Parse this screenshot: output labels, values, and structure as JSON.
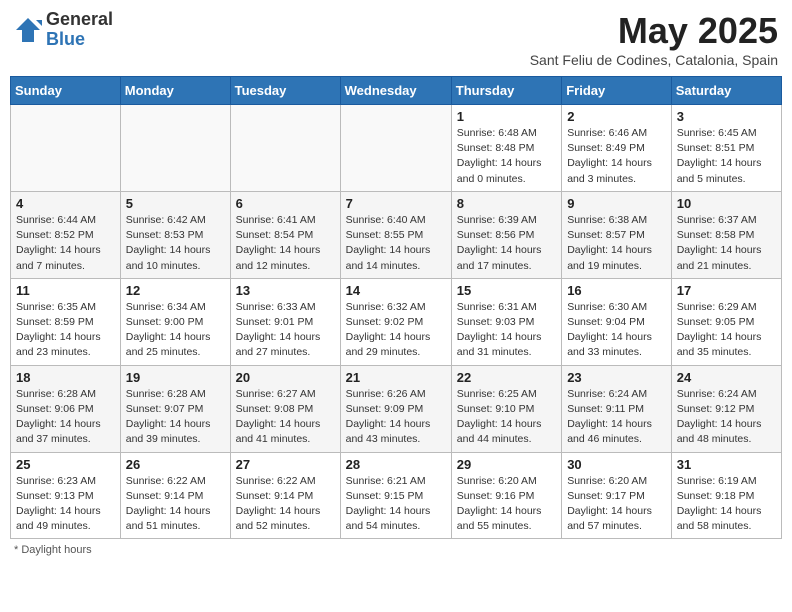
{
  "header": {
    "logo_general": "General",
    "logo_blue": "Blue",
    "month_title": "May 2025",
    "location": "Sant Feliu de Codines, Catalonia, Spain"
  },
  "weekdays": [
    "Sunday",
    "Monday",
    "Tuesday",
    "Wednesday",
    "Thursday",
    "Friday",
    "Saturday"
  ],
  "weeks": [
    [
      {
        "day": "",
        "info": ""
      },
      {
        "day": "",
        "info": ""
      },
      {
        "day": "",
        "info": ""
      },
      {
        "day": "",
        "info": ""
      },
      {
        "day": "1",
        "info": "Sunrise: 6:48 AM\nSunset: 8:48 PM\nDaylight: 14 hours and 0 minutes."
      },
      {
        "day": "2",
        "info": "Sunrise: 6:46 AM\nSunset: 8:49 PM\nDaylight: 14 hours and 3 minutes."
      },
      {
        "day": "3",
        "info": "Sunrise: 6:45 AM\nSunset: 8:51 PM\nDaylight: 14 hours and 5 minutes."
      }
    ],
    [
      {
        "day": "4",
        "info": "Sunrise: 6:44 AM\nSunset: 8:52 PM\nDaylight: 14 hours and 7 minutes."
      },
      {
        "day": "5",
        "info": "Sunrise: 6:42 AM\nSunset: 8:53 PM\nDaylight: 14 hours and 10 minutes."
      },
      {
        "day": "6",
        "info": "Sunrise: 6:41 AM\nSunset: 8:54 PM\nDaylight: 14 hours and 12 minutes."
      },
      {
        "day": "7",
        "info": "Sunrise: 6:40 AM\nSunset: 8:55 PM\nDaylight: 14 hours and 14 minutes."
      },
      {
        "day": "8",
        "info": "Sunrise: 6:39 AM\nSunset: 8:56 PM\nDaylight: 14 hours and 17 minutes."
      },
      {
        "day": "9",
        "info": "Sunrise: 6:38 AM\nSunset: 8:57 PM\nDaylight: 14 hours and 19 minutes."
      },
      {
        "day": "10",
        "info": "Sunrise: 6:37 AM\nSunset: 8:58 PM\nDaylight: 14 hours and 21 minutes."
      }
    ],
    [
      {
        "day": "11",
        "info": "Sunrise: 6:35 AM\nSunset: 8:59 PM\nDaylight: 14 hours and 23 minutes."
      },
      {
        "day": "12",
        "info": "Sunrise: 6:34 AM\nSunset: 9:00 PM\nDaylight: 14 hours and 25 minutes."
      },
      {
        "day": "13",
        "info": "Sunrise: 6:33 AM\nSunset: 9:01 PM\nDaylight: 14 hours and 27 minutes."
      },
      {
        "day": "14",
        "info": "Sunrise: 6:32 AM\nSunset: 9:02 PM\nDaylight: 14 hours and 29 minutes."
      },
      {
        "day": "15",
        "info": "Sunrise: 6:31 AM\nSunset: 9:03 PM\nDaylight: 14 hours and 31 minutes."
      },
      {
        "day": "16",
        "info": "Sunrise: 6:30 AM\nSunset: 9:04 PM\nDaylight: 14 hours and 33 minutes."
      },
      {
        "day": "17",
        "info": "Sunrise: 6:29 AM\nSunset: 9:05 PM\nDaylight: 14 hours and 35 minutes."
      }
    ],
    [
      {
        "day": "18",
        "info": "Sunrise: 6:28 AM\nSunset: 9:06 PM\nDaylight: 14 hours and 37 minutes."
      },
      {
        "day": "19",
        "info": "Sunrise: 6:28 AM\nSunset: 9:07 PM\nDaylight: 14 hours and 39 minutes."
      },
      {
        "day": "20",
        "info": "Sunrise: 6:27 AM\nSunset: 9:08 PM\nDaylight: 14 hours and 41 minutes."
      },
      {
        "day": "21",
        "info": "Sunrise: 6:26 AM\nSunset: 9:09 PM\nDaylight: 14 hours and 43 minutes."
      },
      {
        "day": "22",
        "info": "Sunrise: 6:25 AM\nSunset: 9:10 PM\nDaylight: 14 hours and 44 minutes."
      },
      {
        "day": "23",
        "info": "Sunrise: 6:24 AM\nSunset: 9:11 PM\nDaylight: 14 hours and 46 minutes."
      },
      {
        "day": "24",
        "info": "Sunrise: 6:24 AM\nSunset: 9:12 PM\nDaylight: 14 hours and 48 minutes."
      }
    ],
    [
      {
        "day": "25",
        "info": "Sunrise: 6:23 AM\nSunset: 9:13 PM\nDaylight: 14 hours and 49 minutes."
      },
      {
        "day": "26",
        "info": "Sunrise: 6:22 AM\nSunset: 9:14 PM\nDaylight: 14 hours and 51 minutes."
      },
      {
        "day": "27",
        "info": "Sunrise: 6:22 AM\nSunset: 9:14 PM\nDaylight: 14 hours and 52 minutes."
      },
      {
        "day": "28",
        "info": "Sunrise: 6:21 AM\nSunset: 9:15 PM\nDaylight: 14 hours and 54 minutes."
      },
      {
        "day": "29",
        "info": "Sunrise: 6:20 AM\nSunset: 9:16 PM\nDaylight: 14 hours and 55 minutes."
      },
      {
        "day": "30",
        "info": "Sunrise: 6:20 AM\nSunset: 9:17 PM\nDaylight: 14 hours and 57 minutes."
      },
      {
        "day": "31",
        "info": "Sunrise: 6:19 AM\nSunset: 9:18 PM\nDaylight: 14 hours and 58 minutes."
      }
    ]
  ],
  "footer": "Daylight hours"
}
